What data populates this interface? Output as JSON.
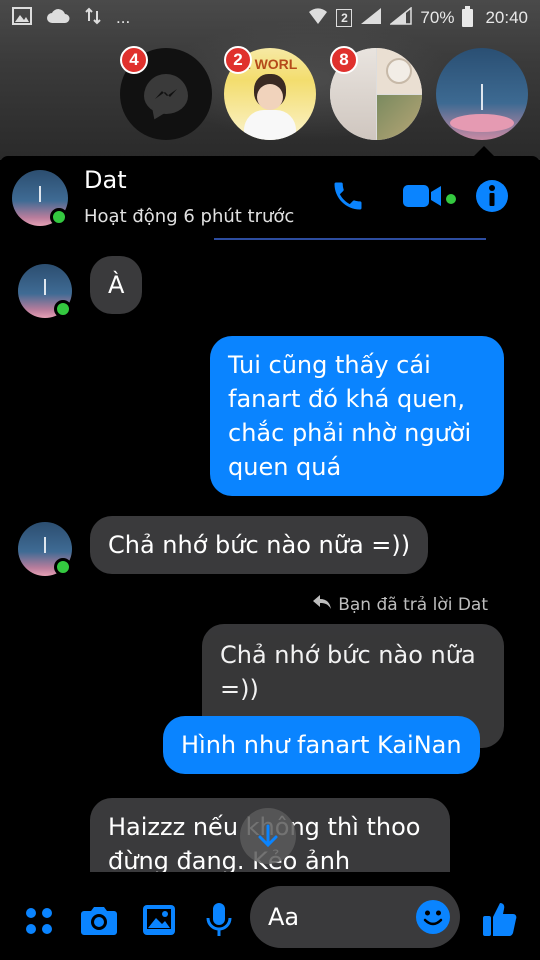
{
  "status_bar": {
    "dots": "...",
    "sim": "2",
    "battery": "70%",
    "time": "20:40"
  },
  "chat_heads": {
    "messenger_badge": "4",
    "head2_badge": "2",
    "head2_caption": "PE WORL",
    "head3_badge": "8"
  },
  "conversation": {
    "contact_name": "Dat",
    "contact_status": "Hoạt động 6 phút trước"
  },
  "messages": {
    "m1": "À",
    "m2": "Tui cũng thấy cái fanart đó khá quen, chắc phải nhờ người quen quá",
    "m3": "Chả nhớ bức nào nữa =))",
    "reply_note": "Bạn đã trả lời Dat",
    "quoted": "Chả nhớ bức nào nữa =))",
    "m4": "Hình như fanart KaiNan",
    "m5_partial": "Haizzz nếu không thì thoo đừng đang. Kẻo ảnh"
  },
  "composer": {
    "placeholder": "Aa"
  },
  "colors": {
    "accent": "#0a84ff",
    "incoming_bubble": "#3a3a3c",
    "online": "#34c940",
    "badge": "#e0312d"
  },
  "icons": [
    "gallery-icon",
    "cloud-icon",
    "data-arrows-icon",
    "wifi-icon",
    "signal-icon",
    "battery-icon",
    "messenger-icon",
    "phone-icon",
    "video-icon",
    "info-icon",
    "reply-icon",
    "arrow-down-icon",
    "apps-icon",
    "camera-icon",
    "image-icon",
    "microphone-icon",
    "emoji-icon",
    "like-icon"
  ]
}
